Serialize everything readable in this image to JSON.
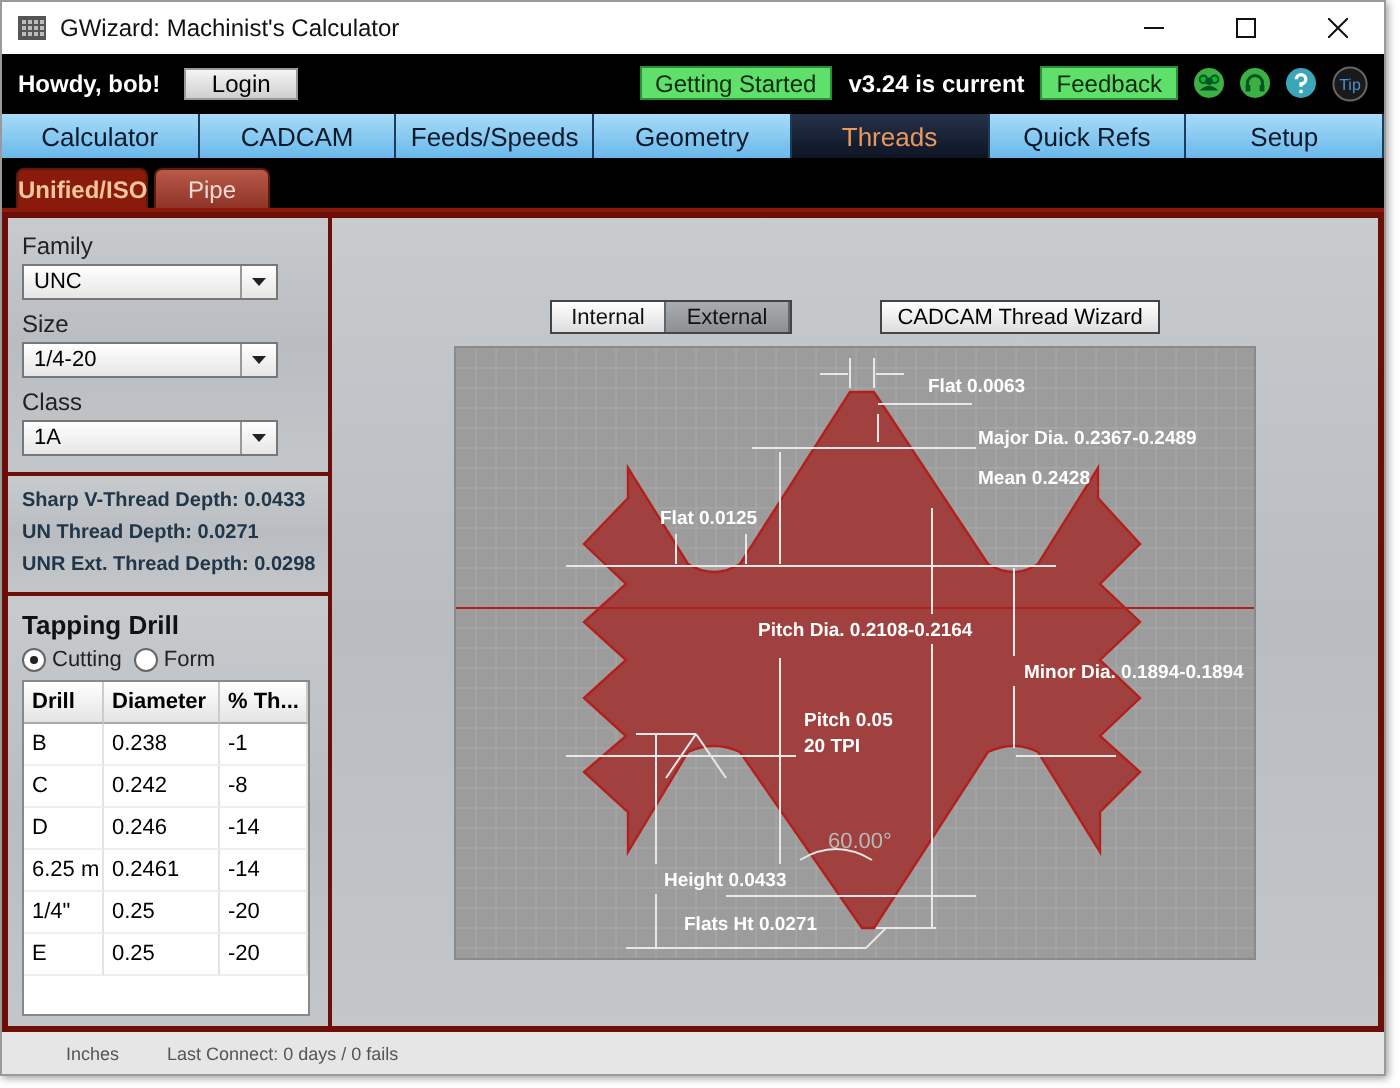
{
  "window": {
    "title": "GWizard: Machinist's Calculator"
  },
  "header": {
    "greeting": "Howdy, bob!",
    "login": "Login",
    "getting_started": "Getting Started",
    "version": "v3.24 is current",
    "feedback": "Feedback",
    "tip": "Tip"
  },
  "tabs": [
    {
      "label": "Calculator",
      "selected": false
    },
    {
      "label": "CADCAM",
      "selected": false
    },
    {
      "label": "Feeds/Speeds",
      "selected": false
    },
    {
      "label": "Geometry",
      "selected": false
    },
    {
      "label": "Threads",
      "selected": true
    },
    {
      "label": "Quick Refs",
      "selected": false
    },
    {
      "label": "Setup",
      "selected": false
    }
  ],
  "subtabs": [
    {
      "label": "Unified/ISO",
      "selected": true
    },
    {
      "label": "Pipe",
      "selected": false
    }
  ],
  "selectors": [
    {
      "label": "Family",
      "value": "UNC"
    },
    {
      "label": "Size",
      "value": "1/4-20"
    },
    {
      "label": "Class",
      "value": "1A"
    }
  ],
  "depths": [
    "Sharp V-Thread Depth: 0.0433",
    "UN Thread Depth: 0.0271",
    "UNR Ext. Thread Depth: 0.0298"
  ],
  "tapping_drill": {
    "title": "Tapping Drill",
    "modes": [
      {
        "label": "Cutting",
        "selected": true
      },
      {
        "label": "Form",
        "selected": false
      }
    ],
    "columns": [
      "Drill",
      "Diameter",
      "% Th..."
    ],
    "rows": [
      [
        "B",
        "0.238",
        "-1"
      ],
      [
        "C",
        "0.242",
        "-8"
      ],
      [
        "D",
        "0.246",
        "-14"
      ],
      [
        "6.25 m",
        "0.2461",
        "-14"
      ],
      [
        "1/4\"",
        "0.25",
        "-20"
      ],
      [
        "E",
        "0.25",
        "-20"
      ]
    ]
  },
  "thread_type": [
    {
      "label": "Internal",
      "selected": false
    },
    {
      "label": "External",
      "selected": true
    }
  ],
  "wizard_button": "CADCAM Thread Wizard",
  "diagram": {
    "labels": [
      {
        "text": "Flat 0.0063",
        "kind": "dim"
      },
      {
        "text": "Major Dia. 0.2367-0.2489",
        "kind": "dim"
      },
      {
        "text": "Mean 0.2428",
        "kind": "dim"
      },
      {
        "text": "Flat 0.0125",
        "kind": "dim"
      },
      {
        "text": "Pitch Dia. 0.2108-0.2164",
        "kind": "dim"
      },
      {
        "text": "Minor Dia. 0.1894-0.1894",
        "kind": "dim"
      },
      {
        "text": "Pitch 0.05",
        "kind": "dim"
      },
      {
        "text": "20 TPI",
        "kind": "dim"
      },
      {
        "text": "60.00°",
        "kind": "angle"
      },
      {
        "text": "Height 0.0433",
        "kind": "dim"
      },
      {
        "text": "Flats Ht 0.0271",
        "kind": "dim"
      }
    ]
  },
  "status_bar": {
    "units": "Inches",
    "connection": "Last Connect: 0 days / 0 fails"
  }
}
